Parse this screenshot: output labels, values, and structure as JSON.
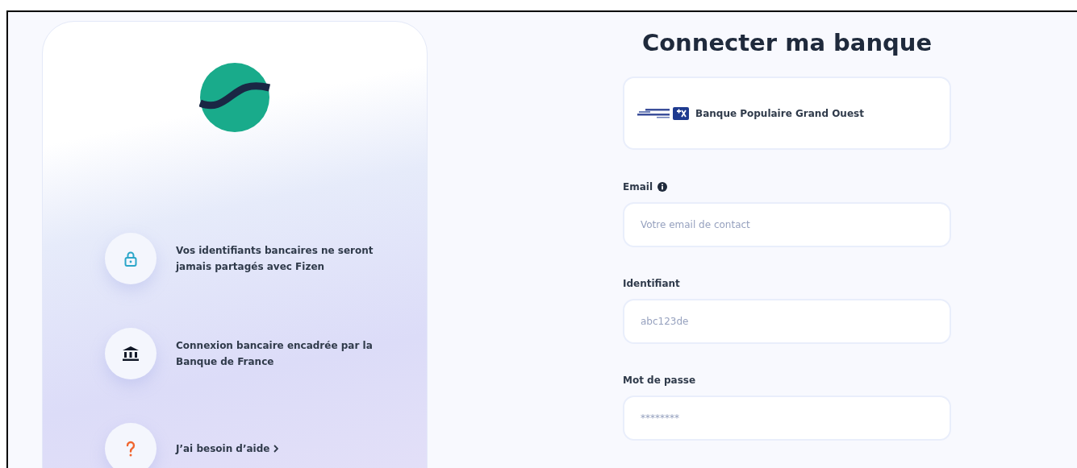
{
  "features": [
    {
      "kind": "lock",
      "text": "Vos identifiants bancaires ne seront jamais partagés avec Fizen"
    },
    {
      "kind": "bank",
      "text": "Connexion bancaire encadrée par la Banque de France"
    },
    {
      "kind": "help",
      "text": "J’ai besoin d’aide",
      "link": true
    }
  ],
  "title": "Connecter ma banque",
  "bank": {
    "name": "Banque Populaire Grand Ouest"
  },
  "fields": [
    {
      "label": "Email",
      "info": true,
      "placeholder": "Votre email de contact"
    },
    {
      "label": "Identifiant",
      "info": false,
      "placeholder": "abc123de"
    },
    {
      "label": "Mot de passe",
      "info": false,
      "placeholder": "********"
    }
  ]
}
